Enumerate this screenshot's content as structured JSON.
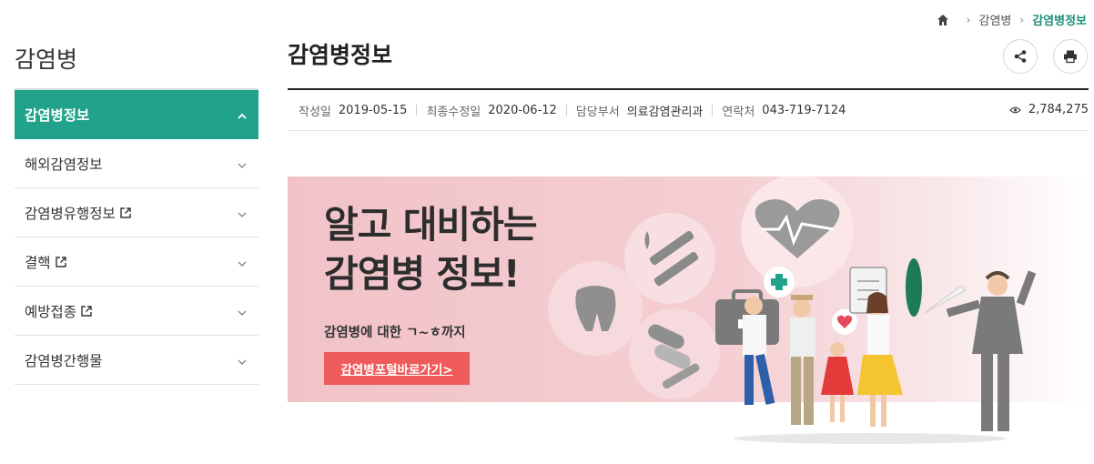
{
  "breadcrumb": {
    "items": [
      "감염병"
    ],
    "current": "감염병정보",
    "separator": ">"
  },
  "sidebar": {
    "title": "감염병",
    "items": [
      {
        "label": "감염병정보",
        "active": true,
        "external": false
      },
      {
        "label": "해외감염정보",
        "active": false,
        "external": false
      },
      {
        "label": "감염병유행정보",
        "active": false,
        "external": true
      },
      {
        "label": "결핵",
        "active": false,
        "external": true
      },
      {
        "label": "예방접종",
        "active": false,
        "external": true
      },
      {
        "label": "감염병간행물",
        "active": false,
        "external": false
      }
    ]
  },
  "main": {
    "title": "감염병정보",
    "meta": {
      "created_label": "작성일",
      "created": "2019-05-15",
      "modified_label": "최종수정일",
      "modified": "2020-06-12",
      "dept_label": "담당부서",
      "dept": "의료감염관리과",
      "contact_label": "연락처",
      "contact": "043-719-7124",
      "views": "2,784,275"
    },
    "banner": {
      "headline_line1": "알고 대비하는",
      "headline_line2": "감염병 정보!",
      "subtitle": "감염병에 대한 ㄱ~ㅎ까지",
      "button_label": "감염병포털바로가기>"
    }
  },
  "colors": {
    "accent": "#21a38b",
    "breadcrumb_current": "#1f8f7a",
    "banner_button": "#ef5a5a",
    "banner_bg": "#f1c3c9"
  },
  "icons": [
    "home-icon",
    "chevron-right-icon",
    "share-icon",
    "print-icon",
    "eye-icon",
    "external-link-icon",
    "chevron-up-icon",
    "chevron-down-icon"
  ]
}
